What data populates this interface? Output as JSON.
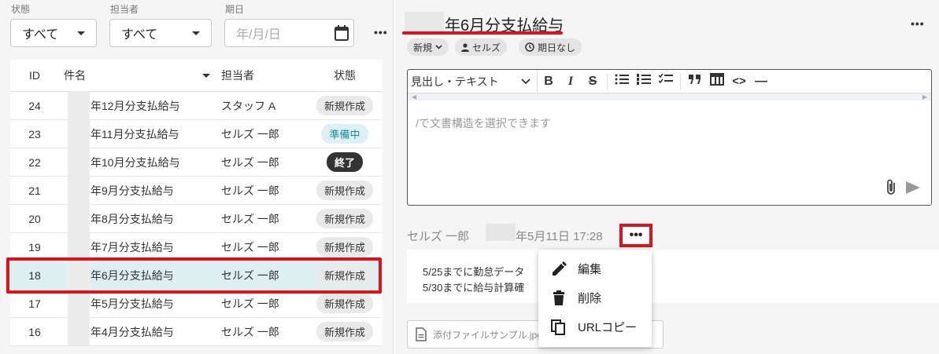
{
  "filters": {
    "status_label": "状態",
    "status_value": "すべて",
    "assignee_label": "担当者",
    "assignee_value": "すべて",
    "due_label": "期日",
    "due_placeholder": "年/月/日",
    "more": "•••"
  },
  "table": {
    "headers": {
      "id": "ID",
      "title": "件名",
      "assignee": "担当者",
      "status": "状態"
    },
    "rows": [
      {
        "id": "24",
        "title": "年12月分支払給与",
        "assignee": "スタッフ A",
        "status": "新規作成",
        "kind": "new"
      },
      {
        "id": "23",
        "title": "年11月分支払給与",
        "assignee": "セルズ 一郎",
        "status": "準備中",
        "kind": "prep"
      },
      {
        "id": "22",
        "title": "年10月分支払給与",
        "assignee": "セルズ 一郎",
        "status": "終了",
        "kind": "done"
      },
      {
        "id": "21",
        "title": "年9月分支払給与",
        "assignee": "セルズ 一郎",
        "status": "新規作成",
        "kind": "new"
      },
      {
        "id": "20",
        "title": "年8月分支払給与",
        "assignee": "セルズ 一郎",
        "status": "新規作成",
        "kind": "new"
      },
      {
        "id": "19",
        "title": "年7月分支払給与",
        "assignee": "セルズ 一郎",
        "status": "新規作成",
        "kind": "new"
      },
      {
        "id": "18",
        "title": "年6月分支払給与",
        "assignee": "セルズ 一郎",
        "status": "新規作成",
        "kind": "new",
        "selected": true
      },
      {
        "id": "17",
        "title": "年5月分支払給与",
        "assignee": "セルズ 一郎",
        "status": "新規作成",
        "kind": "new"
      },
      {
        "id": "16",
        "title": "年4月分支払給与",
        "assignee": "セルズ 一郎",
        "status": "新規作成",
        "kind": "new"
      }
    ]
  },
  "detail": {
    "title": "年6月分支払給与",
    "more": "•••",
    "chip_status": "新規",
    "chip_assignee": "セルズ",
    "chip_due": "期日なし"
  },
  "editor": {
    "block_type": "見出し・テキスト",
    "placeholder": "/で文書構造を選択できます",
    "tools": {
      "bold": "B",
      "italic": "I",
      "strike": "S",
      "code": "<>",
      "hr": "—"
    }
  },
  "comment": {
    "author": "セルズ 一郎",
    "date": "年5月11日 17:28",
    "more": "•••",
    "line1": "5/25までに勤怠データ",
    "line2": "5/30までに給与計算確",
    "attachment": "添付ファイルサンプル.jpg"
  },
  "menu": {
    "edit": "編集",
    "delete": "削除",
    "copy_url": "URLコピー"
  },
  "colors": {
    "highlight_red": "#d9141c",
    "selected_row": "#dfeff1",
    "prep_badge": "#dcf0f5"
  }
}
